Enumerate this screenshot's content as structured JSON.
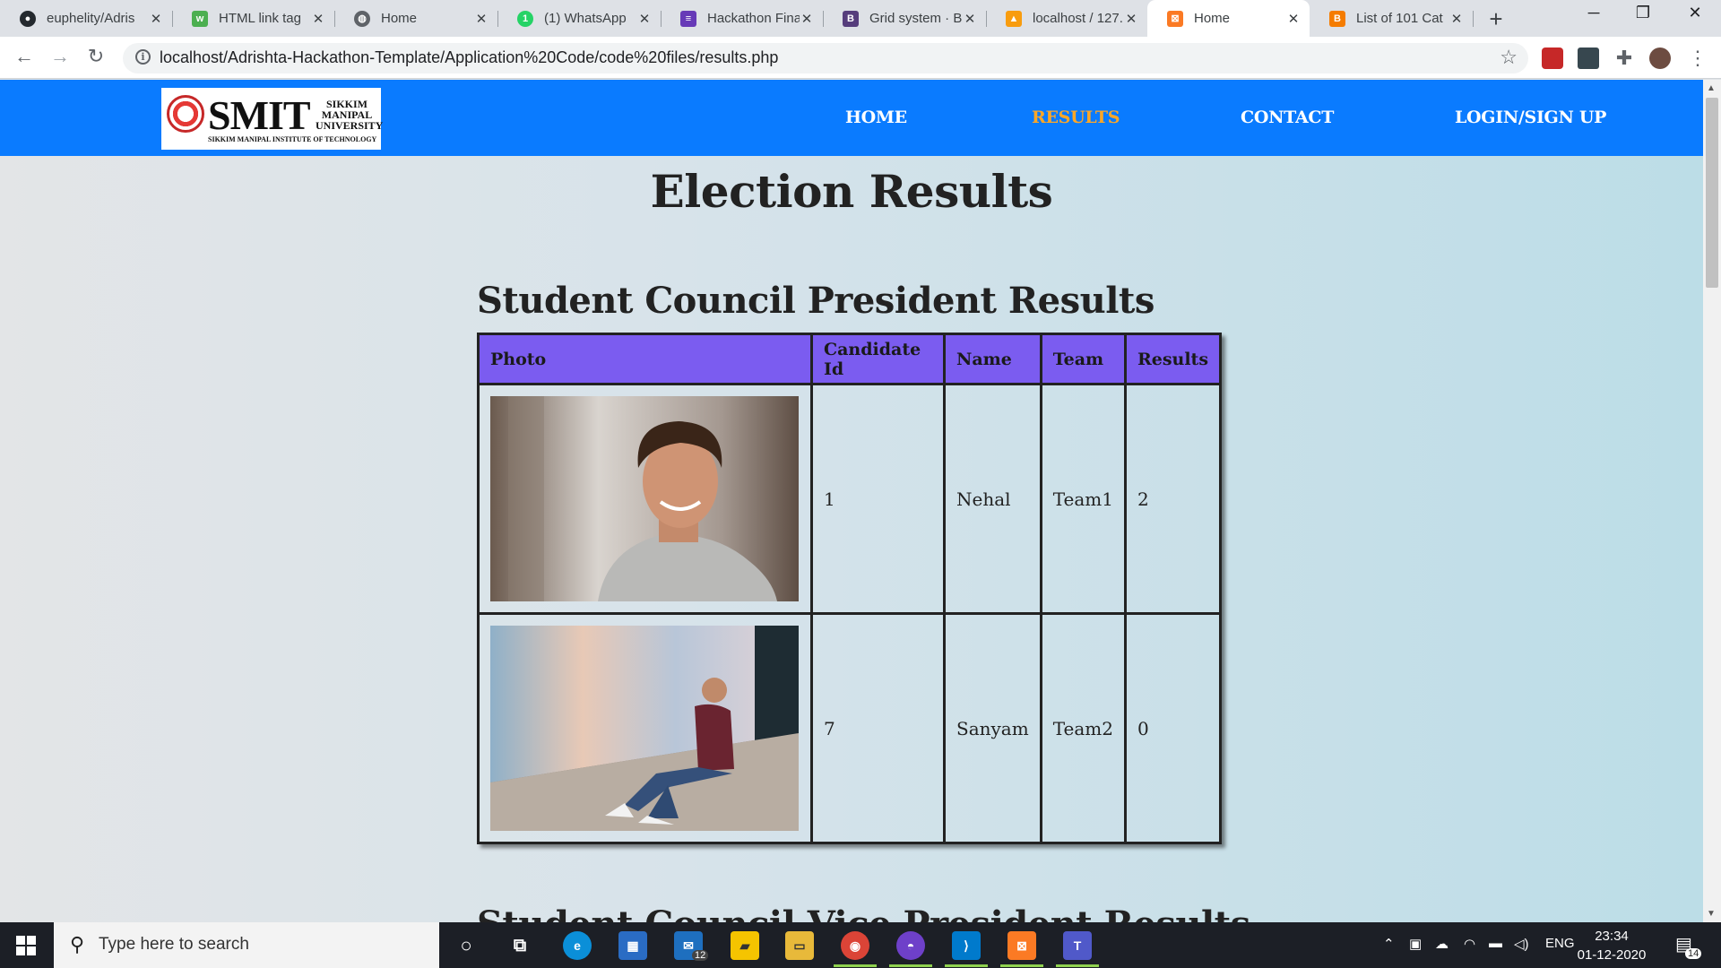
{
  "browser": {
    "tabs": [
      {
        "title": "euphelity/Adris",
        "favicon": "github-icon",
        "color": "#24292e"
      },
      {
        "title": "HTML link tag",
        "favicon": "w3schools-icon",
        "color": "#4caf50"
      },
      {
        "title": "Home",
        "favicon": "globe-icon",
        "color": "#5f6368"
      },
      {
        "title": "(1) WhatsApp",
        "favicon": "whatsapp-icon",
        "color": "#25d366"
      },
      {
        "title": "Hackathon Fina",
        "favicon": "forms-icon",
        "color": "#673ab7"
      },
      {
        "title": "Grid system · B",
        "favicon": "bootstrap-icon",
        "color": "#563d7c"
      },
      {
        "title": "localhost / 127.",
        "favicon": "phpmyadmin-icon",
        "color": "#f89c0e"
      },
      {
        "title": "Home",
        "favicon": "xampp-icon",
        "color": "#fb7a24",
        "active": true
      },
      {
        "title": "List of 101 Cat",
        "favicon": "blogger-icon",
        "color": "#f57c00"
      }
    ],
    "url": "localhost/Adrishta-Hackathon-Template/Application%20Code/code%20files/results.php"
  },
  "site": {
    "logo": {
      "main": "SMIT",
      "side_lines": [
        "SIKKIM",
        "MANIPAL",
        "UNIVERSITY"
      ],
      "subtitle": "SIKKIM MANIPAL INSTITUTE OF TECHNOLOGY"
    },
    "nav": [
      {
        "label": "HOME",
        "active": false
      },
      {
        "label": "RESULTS",
        "active": true
      },
      {
        "label": "CONTACT",
        "active": false
      },
      {
        "label": "LOGIN/SIGN UP",
        "active": false
      }
    ]
  },
  "page": {
    "title": "Election Results",
    "section_title": "Student Council President Results",
    "next_section_title": "Student Council Vice President Results",
    "table": {
      "headers": [
        "Photo",
        "Candidate Id",
        "Name",
        "Team",
        "Results"
      ],
      "rows": [
        {
          "photo": "smiling-young-man-photo",
          "candidate_id": "1",
          "name": "Nehal",
          "team": "Team1",
          "results": "2"
        },
        {
          "photo": "man-sitting-by-graffiti-wall-photo",
          "candidate_id": "7",
          "name": "Sanyam",
          "team": "Team2",
          "results": "0"
        }
      ]
    }
  },
  "taskbar": {
    "search_placeholder": "Type here to search",
    "mail_badge": "12",
    "language": "ENG",
    "time": "23:34",
    "date": "01-12-2020",
    "notifications": "14"
  },
  "colors": {
    "header_blue": "#0a7bff",
    "nav_active": "#ffa726",
    "table_header": "#7b5cf0"
  }
}
